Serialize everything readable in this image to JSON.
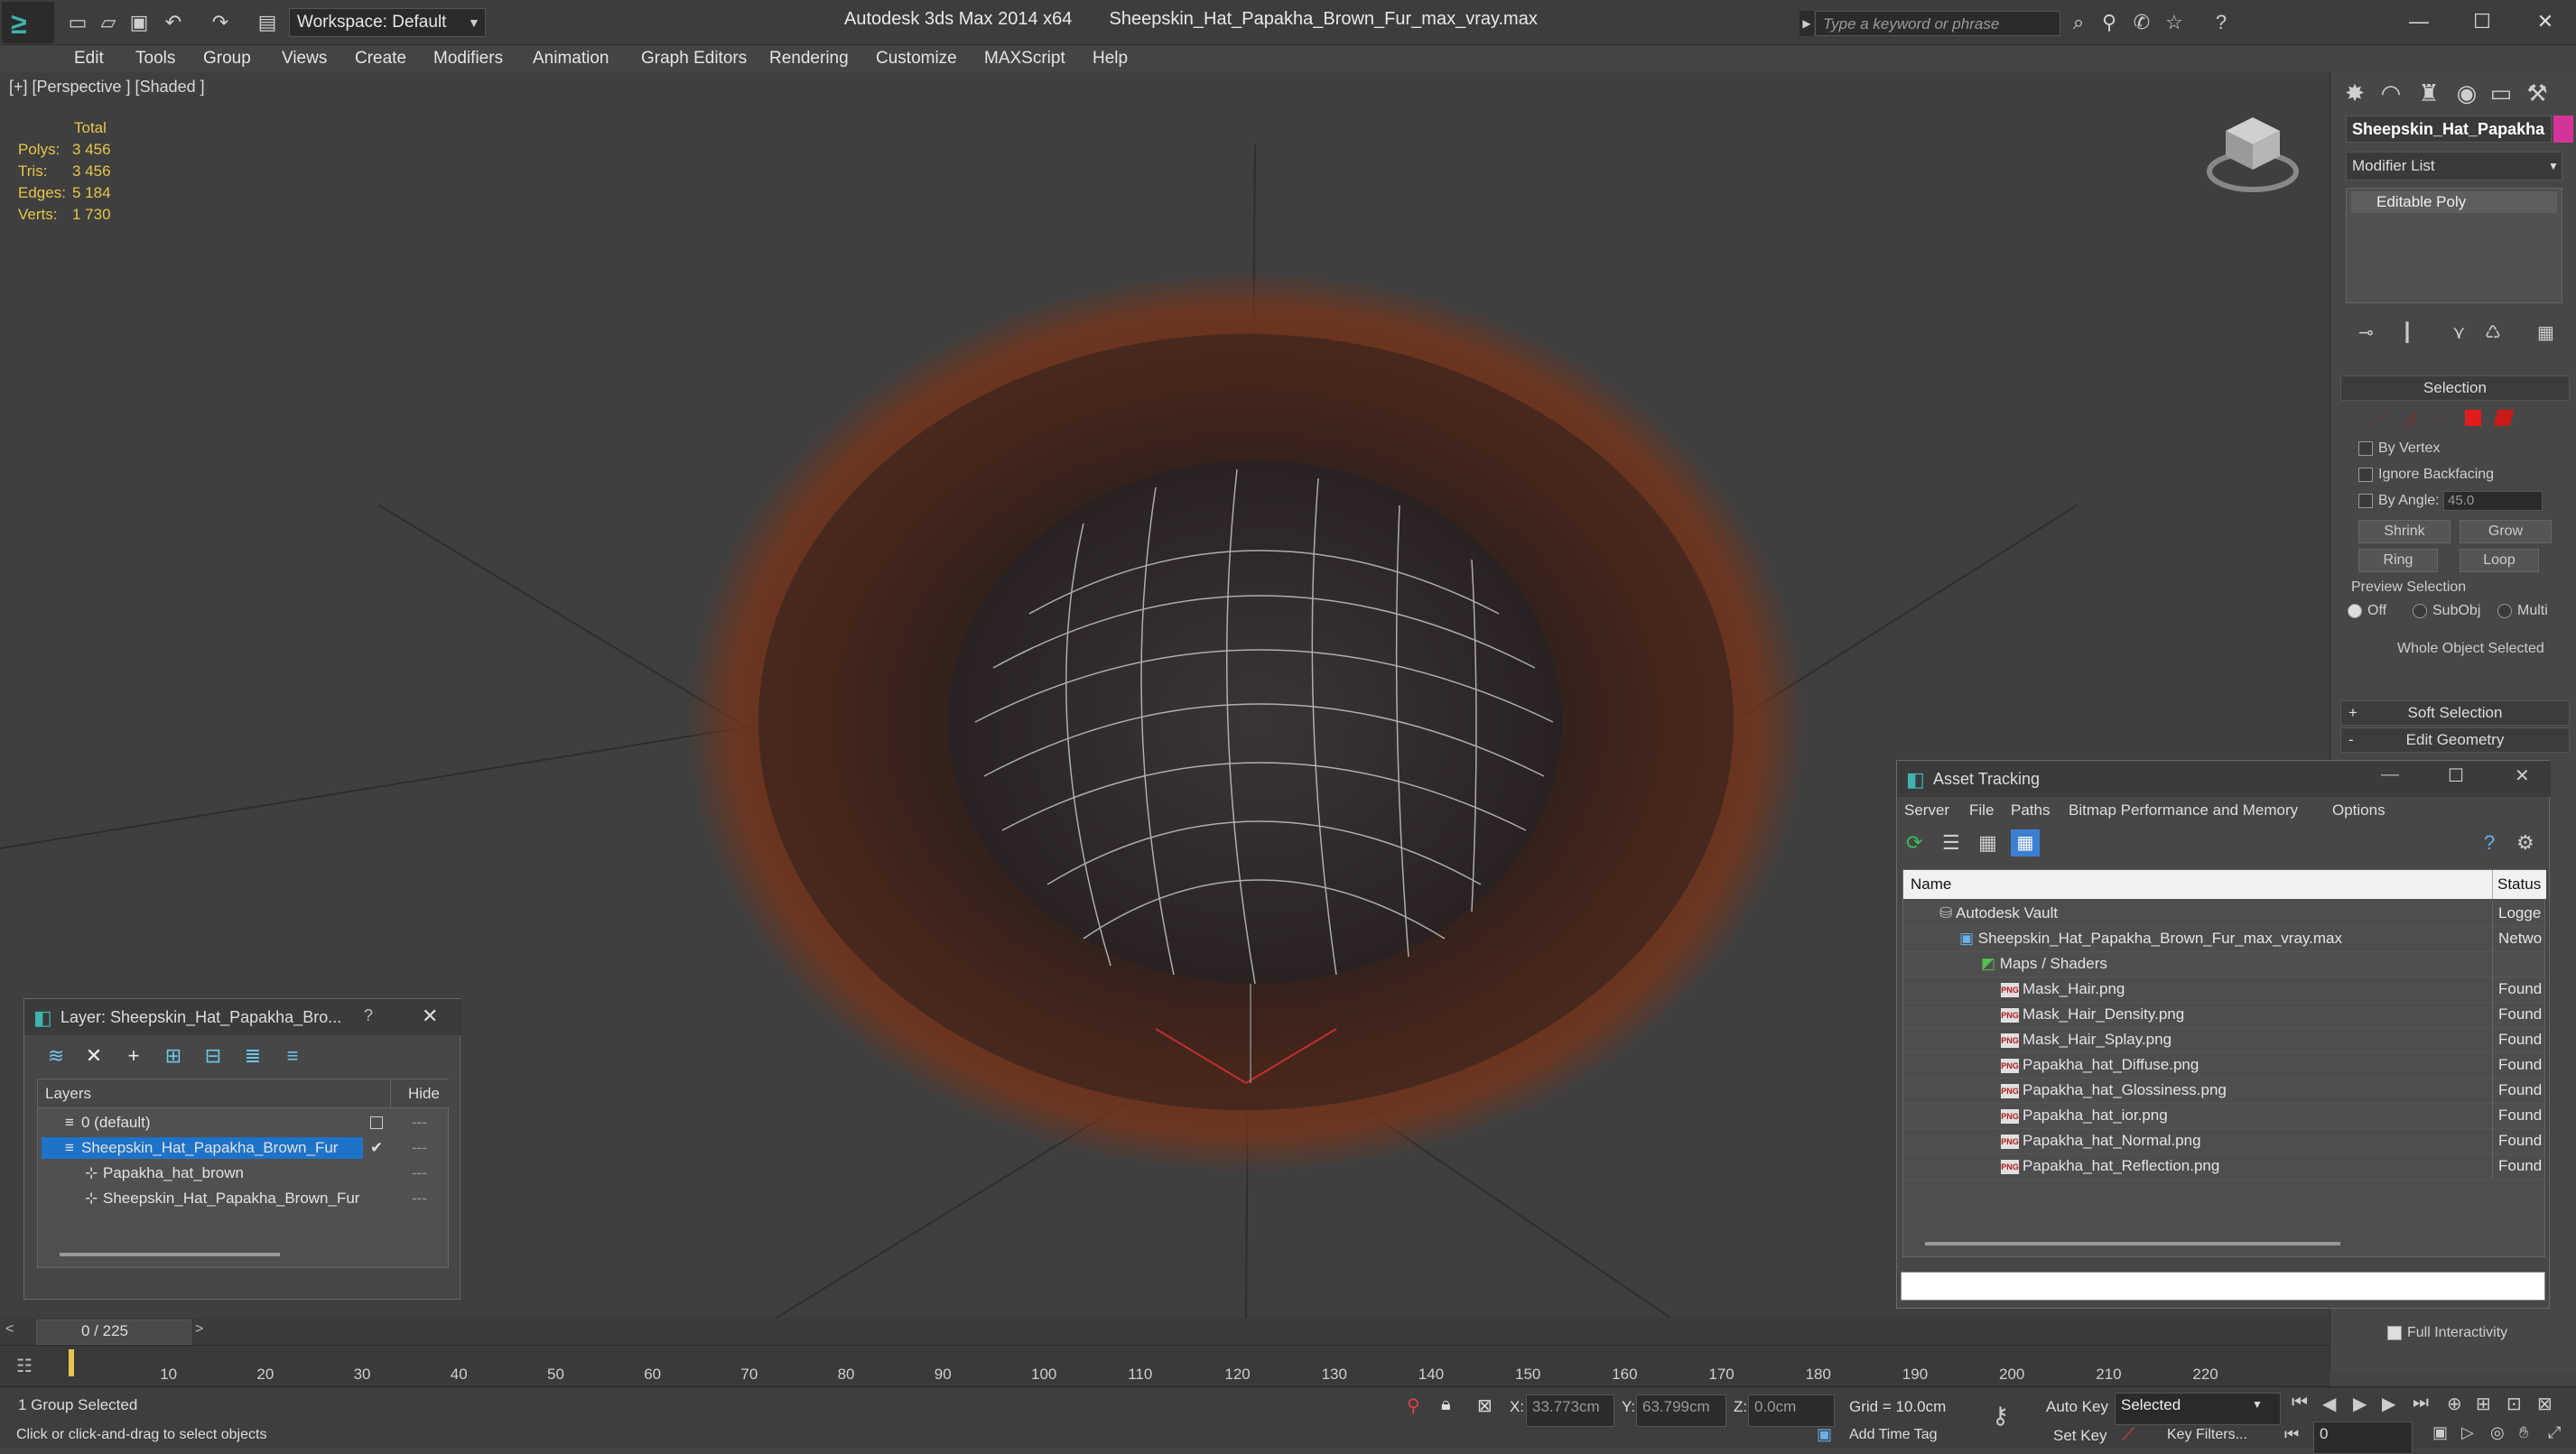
{
  "app": {
    "title": "Autodesk 3ds Max  2014 x64",
    "file": "Sheepskin_Hat_Papakha_Brown_Fur_max_vray.max",
    "workspace": "Workspace: Default",
    "search_placeholder": "Type a keyword or phrase"
  },
  "menu": [
    "Edit",
    "Tools",
    "Group",
    "Views",
    "Create",
    "Modifiers",
    "Animation",
    "Graph Editors",
    "Rendering",
    "Customize",
    "MAXScript",
    "Help"
  ],
  "viewport": {
    "label": "[+] [Perspective ] [Shaded ]",
    "stats": {
      "header": "Total",
      "rows": [
        {
          "label": "Polys:",
          "value": "3 456"
        },
        {
          "label": "Tris:",
          "value": "3 456"
        },
        {
          "label": "Edges:",
          "value": "5 184"
        },
        {
          "label": "Verts:",
          "value": "1 730"
        }
      ]
    }
  },
  "command_panel": {
    "object_name": "Sheepskin_Hat_Papakha",
    "object_color": "#d5339a",
    "modifier_list": "Modifier List",
    "stack_item": "Editable Poly",
    "selection": {
      "title": "Selection",
      "by_vertex": "By Vertex",
      "ignore_backfacing": "Ignore Backfacing",
      "by_angle": "By Angle:",
      "angle_value": "45.0",
      "shrink": "Shrink",
      "grow": "Grow",
      "ring": "Ring",
      "loop": "Loop",
      "preview_selection": "Preview Selection",
      "off": "Off",
      "subobj": "SubObj",
      "multi": "Multi",
      "whole_object": "Whole Object Selected"
    },
    "soft_selection": "Soft Selection",
    "edit_geometry": "Edit Geometry",
    "full_interactivity": "Full Interactivity"
  },
  "layer_window": {
    "title": "Layer: Sheepskin_Hat_Papakha_Bro...",
    "help": "?",
    "col_layers": "Layers",
    "col_hide": "Hide",
    "rows": [
      {
        "name": "0 (default)",
        "indent": 0,
        "selected": false
      },
      {
        "name": "Sheepskin_Hat_Papakha_Brown_Fur",
        "indent": 0,
        "selected": true
      },
      {
        "name": "Papakha_hat_brown",
        "indent": 1,
        "selected": false
      },
      {
        "name": "Sheepskin_Hat_Papakha_Brown_Fur",
        "indent": 1,
        "selected": false
      }
    ]
  },
  "asset_tracking": {
    "title": "Asset Tracking",
    "menu": [
      "Server",
      "File",
      "Paths",
      "Bitmap Performance and Memory",
      "Options"
    ],
    "col_name": "Name",
    "col_status": "Status",
    "rows": [
      {
        "name": "Autodesk Vault",
        "status": "Logge",
        "indent": 1,
        "kind": "vault"
      },
      {
        "name": "Sheepskin_Hat_Papakha_Brown_Fur_max_vray.max",
        "status": "Netwo",
        "indent": 2,
        "kind": "max"
      },
      {
        "name": "Maps / Shaders",
        "status": "",
        "indent": 3,
        "kind": "folder"
      },
      {
        "name": "Mask_Hair.png",
        "status": "Found",
        "indent": 4,
        "kind": "png"
      },
      {
        "name": "Mask_Hair_Density.png",
        "status": "Found",
        "indent": 4,
        "kind": "png"
      },
      {
        "name": "Mask_Hair_Splay.png",
        "status": "Found",
        "indent": 4,
        "kind": "png"
      },
      {
        "name": "Papakha_hat_Diffuse.png",
        "status": "Found",
        "indent": 4,
        "kind": "png"
      },
      {
        "name": "Papakha_hat_Glossiness.png",
        "status": "Found",
        "indent": 4,
        "kind": "png"
      },
      {
        "name": "Papakha_hat_ior.png",
        "status": "Found",
        "indent": 4,
        "kind": "png"
      },
      {
        "name": "Papakha_hat_Normal.png",
        "status": "Found",
        "indent": 4,
        "kind": "png"
      },
      {
        "name": "Papakha_hat_Reflection.png",
        "status": "Found",
        "indent": 4,
        "kind": "png"
      }
    ],
    "png_badge": "PNG"
  },
  "timeline": {
    "frame": "0 / 225",
    "ticks": [
      "10",
      "20",
      "30",
      "40",
      "50",
      "60",
      "70",
      "80",
      "90",
      "100",
      "110",
      "120",
      "130",
      "140",
      "150",
      "160",
      "170",
      "180",
      "190",
      "200",
      "210",
      "220"
    ]
  },
  "status": {
    "selection": "1 Group Selected",
    "prompt": "Click or click-and-drag to select objects",
    "x_label": "X:",
    "x_value": "33.773cm",
    "y_label": "Y:",
    "y_value": "63.799cm",
    "z_label": "Z:",
    "z_value": "0.0cm",
    "grid": "Grid = 10.0cm",
    "add_time_tag": "Add Time Tag",
    "auto_key": "Auto Key",
    "set_key": "Set Key",
    "selected_dropdown": "Selected",
    "key_filters": "Key Filters...",
    "frame_field": "0"
  }
}
